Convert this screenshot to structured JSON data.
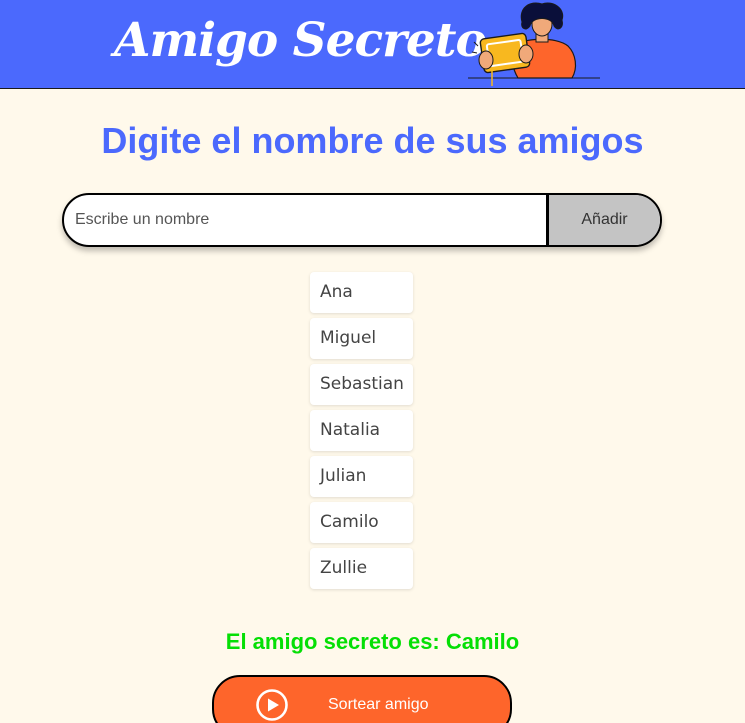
{
  "header": {
    "title": "Amigo Secreto",
    "illustration_icon": "person-with-gift-illustration"
  },
  "main": {
    "title": "Digite el nombre de sus amigos",
    "input": {
      "placeholder": "Escribe un nombre",
      "value": ""
    },
    "add_button_label": "Añadir",
    "friends": [
      "Ana",
      "Miguel",
      "Sebastian",
      "Natalia",
      "Julian",
      "Camilo",
      "Zullie"
    ],
    "result_text": "El amigo secreto es: Camilo",
    "draw_button": {
      "label": "Sortear amigo",
      "icon": "play-circle-icon"
    }
  },
  "colors": {
    "header_bg": "#4B69FD",
    "page_bg": "#FFF9EB",
    "title": "#4B69FD",
    "result": "#05DF05",
    "draw_button": "#FE652B",
    "add_button": "#C4C4C4"
  }
}
